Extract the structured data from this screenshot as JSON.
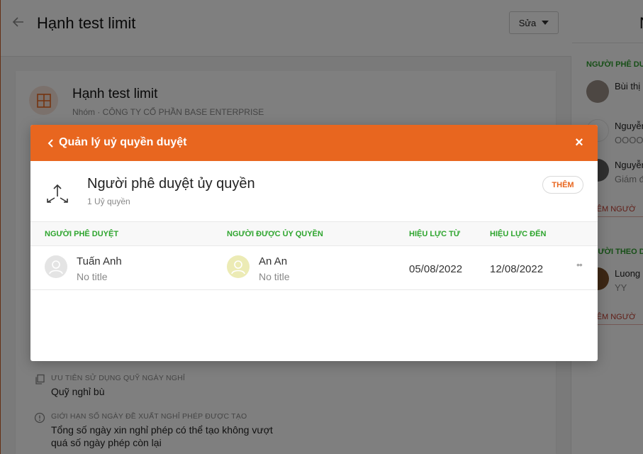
{
  "page": {
    "title": "Hạnh test limit",
    "edit_label": "Sửa"
  },
  "group": {
    "title": "Hạnh test limit",
    "subtitle": "Nhóm · CÔNG TY CỔ PHẦN BASE ENTERPRISE"
  },
  "fields": [
    {
      "label": "ƯU TIÊN SỬ DỤNG QUỸ NGÀY NGHỈ",
      "value": "Quỹ nghỉ bù"
    },
    {
      "label": "GIỚI HẠN SỐ NGÀY ĐỀ XUẤT NGHỈ PHÉP ĐƯỢC TẠO",
      "value_line1": "Tổng số ngày xin nghỉ phép có thể tạo không vượt",
      "value_line2": "quá số ngày phép còn lại"
    }
  ],
  "right_panel": {
    "title_fragment": "N",
    "approvers_heading": "NGƯỜI PHÊ DU",
    "approvers": [
      {
        "name": "Bùi thị",
        "sub": ""
      },
      {
        "name": "Nguyễn",
        "sub": "OOOOO"
      },
      {
        "name": "Nguyễn",
        "sub": "Giám đ"
      }
    ],
    "add_approver": "THÊM NGƯỜ",
    "followers_heading": "NGƯỜI THEO D",
    "followers": [
      {
        "name": "Luong",
        "sub": "YY"
      }
    ],
    "add_follower": "THÊM NGƯỜ"
  },
  "modal": {
    "header_title": "Quản lý uỷ quyền duyệt",
    "delegation_title": "Người phê duyệt ủy quyền",
    "delegation_count": "1 Uỷ quyền",
    "add_label": "THÊM",
    "columns": {
      "approver": "NGƯỜI PHÊ DUYỆT",
      "delegate": "NGƯỜI ĐƯỢC ỦY QUYỀN",
      "valid_from": "HIỆU LỰC TỪ",
      "valid_to": "HIỆU LỰC ĐẾN"
    },
    "rows": [
      {
        "approver_name": "Tuấn Anh",
        "approver_title": "No title",
        "delegate_name": "An An",
        "delegate_title": "No title",
        "valid_from": "05/08/2022",
        "valid_to": "12/08/2022"
      }
    ]
  },
  "colors": {
    "accent": "#e8661f",
    "green": "#2ea52e"
  }
}
